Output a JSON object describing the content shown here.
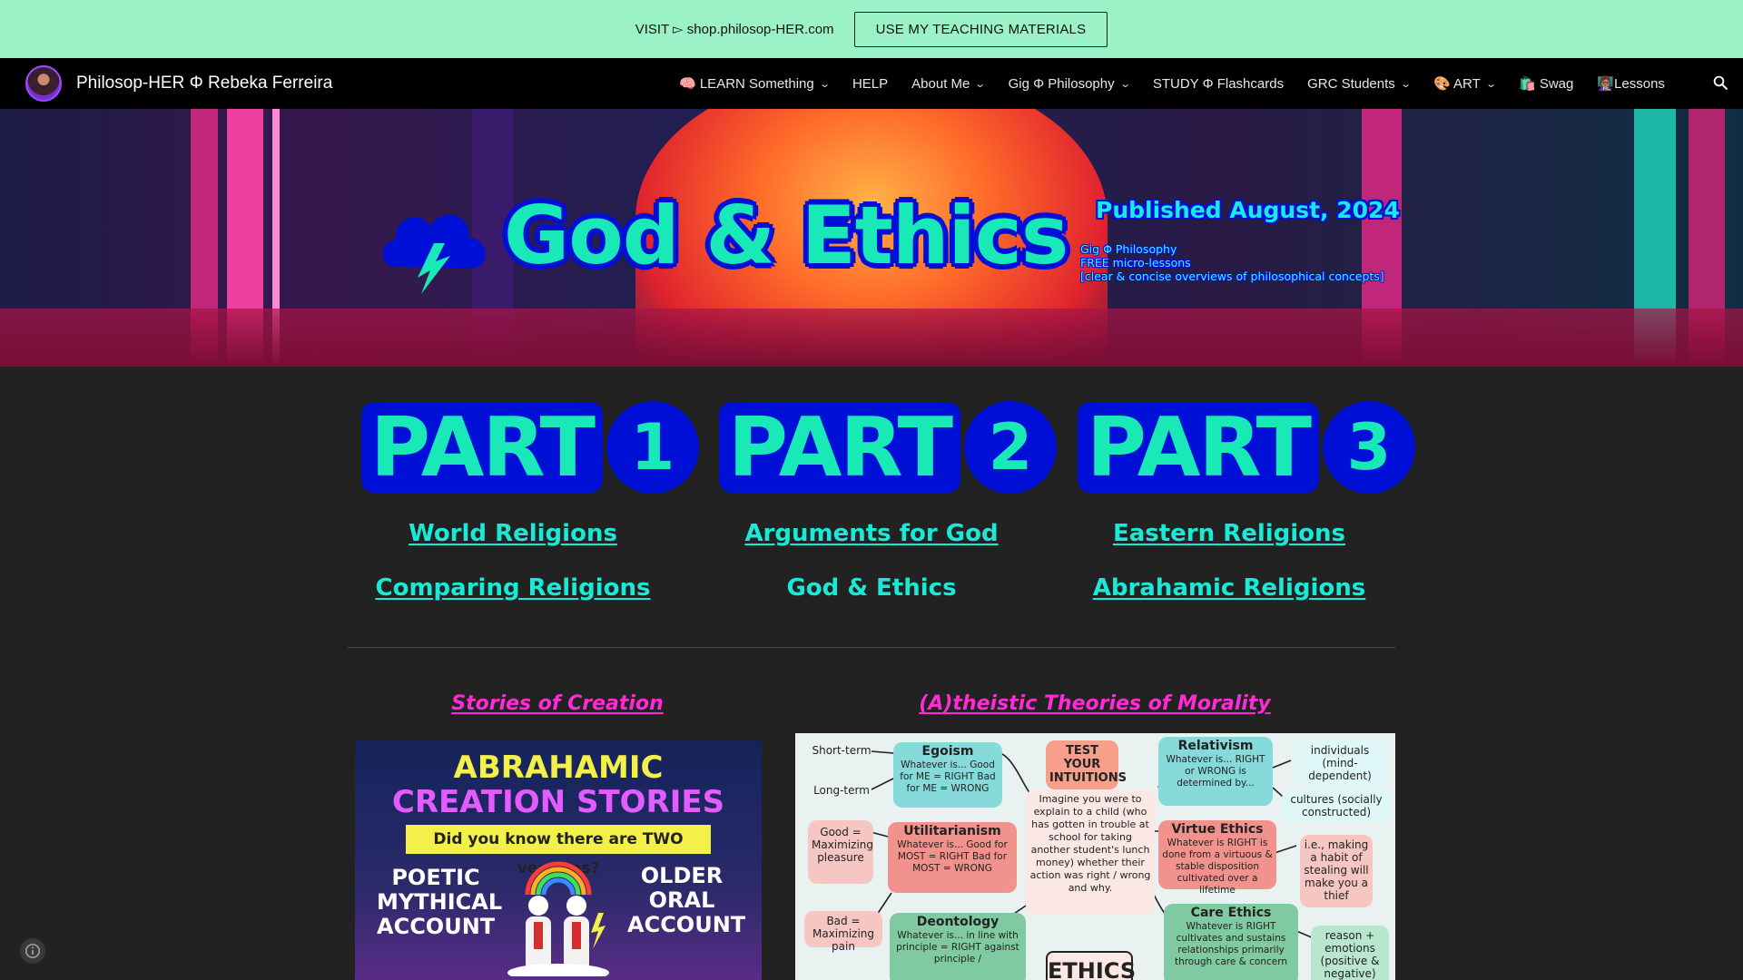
{
  "promo": {
    "text": "VISIT ▻ shop.philosop-HER.com",
    "button": "USE MY TEACHING MATERIALS"
  },
  "nav": {
    "site_title": "Philosop-HER Φ Rebeka Ferreira",
    "items": [
      {
        "label": "🧠 LEARN Something",
        "dropdown": true
      },
      {
        "label": "HELP",
        "dropdown": false
      },
      {
        "label": "About Me",
        "dropdown": true
      },
      {
        "label": "Gig Φ Philosophy",
        "dropdown": true
      },
      {
        "label": "STUDY Φ Flashcards",
        "dropdown": false
      },
      {
        "label": "GRC Students",
        "dropdown": true
      },
      {
        "label": "🎨 ART",
        "dropdown": true
      },
      {
        "label": "🛍️ Swag",
        "dropdown": false
      },
      {
        "label": "👩🏽‍🏫Lessons",
        "dropdown": false
      }
    ],
    "search_icon": "search-icon"
  },
  "hero": {
    "title": "God & Ethics",
    "published": "Published August, 2024",
    "sub_lines": [
      "Gig Φ Philosophy",
      "FREE micro-lessons",
      "[clear & concise overviews of philosophical concepts]"
    ]
  },
  "parts": [
    {
      "word": "PART",
      "num": "1",
      "links": [
        "World Religions",
        "Comparing Religions"
      ]
    },
    {
      "word": "PART",
      "num": "2",
      "links": [
        "Arguments for God",
        "God & Ethics"
      ]
    },
    {
      "word": "PART",
      "num": "3",
      "links": [
        "Eastern Religions",
        "Abrahamic Religions"
      ]
    }
  ],
  "sections": {
    "left_title": "Stories of Creation",
    "right_title": "(A)theistic Theories of Morality"
  },
  "poster": {
    "line1": "ABRAHAMIC",
    "line2": "CREATION STORIES",
    "question": "Did you know there are TWO versions?",
    "left": "POETIC MYTHICAL ACCOUNT",
    "right": "OLDER ORAL ACCOUNT"
  },
  "chart": {
    "short_term": "Short-term",
    "long_term": "Long-term",
    "egoism_title": "Egoism",
    "egoism_text": "Whatever is... Good for ME = RIGHT Bad for ME = WRONG",
    "test_title": "TEST YOUR INTUITIONS",
    "relativism_title": "Relativism",
    "relativism_text": "Whatever is... RIGHT or WRONG is determined by...",
    "individuals": "individuals (mind-dependent)",
    "cultures": "cultures (socially constructed)",
    "good_max": "Good = Maximizing pleasure",
    "util_title": "Utilitarianism",
    "util_text": "Whatever is... Good for MOST = RIGHT Bad for MOST = WRONG",
    "center_text": "Imagine you were to explain to a child (who has gotten in trouble at school for taking another student's lunch money) whether their action was right / wrong and why.",
    "virtue_title": "Virtue Ethics",
    "virtue_text": "Whatever is RIGHT is done from a virtuous & stable disposition cultivated over a lifetime",
    "virtue_side": "i.e., making a habit of stealing will make you a thief",
    "bad_max": "Bad = Maximizing pain",
    "deon_title": "Deontology",
    "deon_text": "Whatever is... in line with principle = RIGHT against principle /",
    "care_title": "Care Ethics",
    "care_text": "Whatever is RIGHT cultivates and sustains relationships primarily through care & concern",
    "reason": "reason + emotions (positive & negative)",
    "ethics_label": "ETHICS"
  },
  "colors": {
    "promo_bg": "#9bf2c6",
    "accent_teal": "#19e9b6",
    "accent_blue": "#0010d6",
    "accent_magenta": "#ff2bd6"
  }
}
